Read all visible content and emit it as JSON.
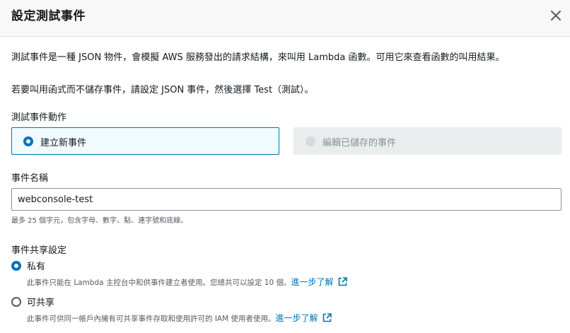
{
  "dialog": {
    "title": "設定測試事件",
    "description_1": "測試事件是一種 JSON 物件，會模擬 AWS 服務發出的請求結構，來叫用 Lambda 函數。可用它來查看函數的叫用結果。",
    "description_2": "若要叫用函式而不儲存事件，請設定 JSON 事件，然後選擇 Test（測試）。"
  },
  "test_event_action": {
    "label": "測試事件動作",
    "options": [
      {
        "label": "建立新事件",
        "selected": true,
        "disabled": false
      },
      {
        "label": "編輯已儲存的事件",
        "selected": false,
        "disabled": true
      }
    ]
  },
  "event_name": {
    "label": "事件名稱",
    "value": "webconsole-test",
    "hint": "最多 25 個字元，包含字母、數字、點、連字號和底線。"
  },
  "sharing": {
    "label": "事件共享設定",
    "options": [
      {
        "label": "私有",
        "selected": true,
        "description": "此事件只能在 Lambda 主控台中和供事件建立者使用。您總共可以設定 10 個。",
        "link": "進一步了解"
      },
      {
        "label": "可共享",
        "selected": false,
        "description": "此事件可供同一帳戶內擁有可共享事件存取和使用許可的 IAM 使用者使用。",
        "link": "進一步了解"
      }
    ]
  },
  "icons": {
    "close": "close-icon",
    "external": "external-link-icon"
  },
  "colors": {
    "accent": "#0073bb",
    "selected_tile_bg": "#f1faff",
    "disabled_tile_bg": "#eaeded",
    "header_bg": "#f8f8f8"
  }
}
